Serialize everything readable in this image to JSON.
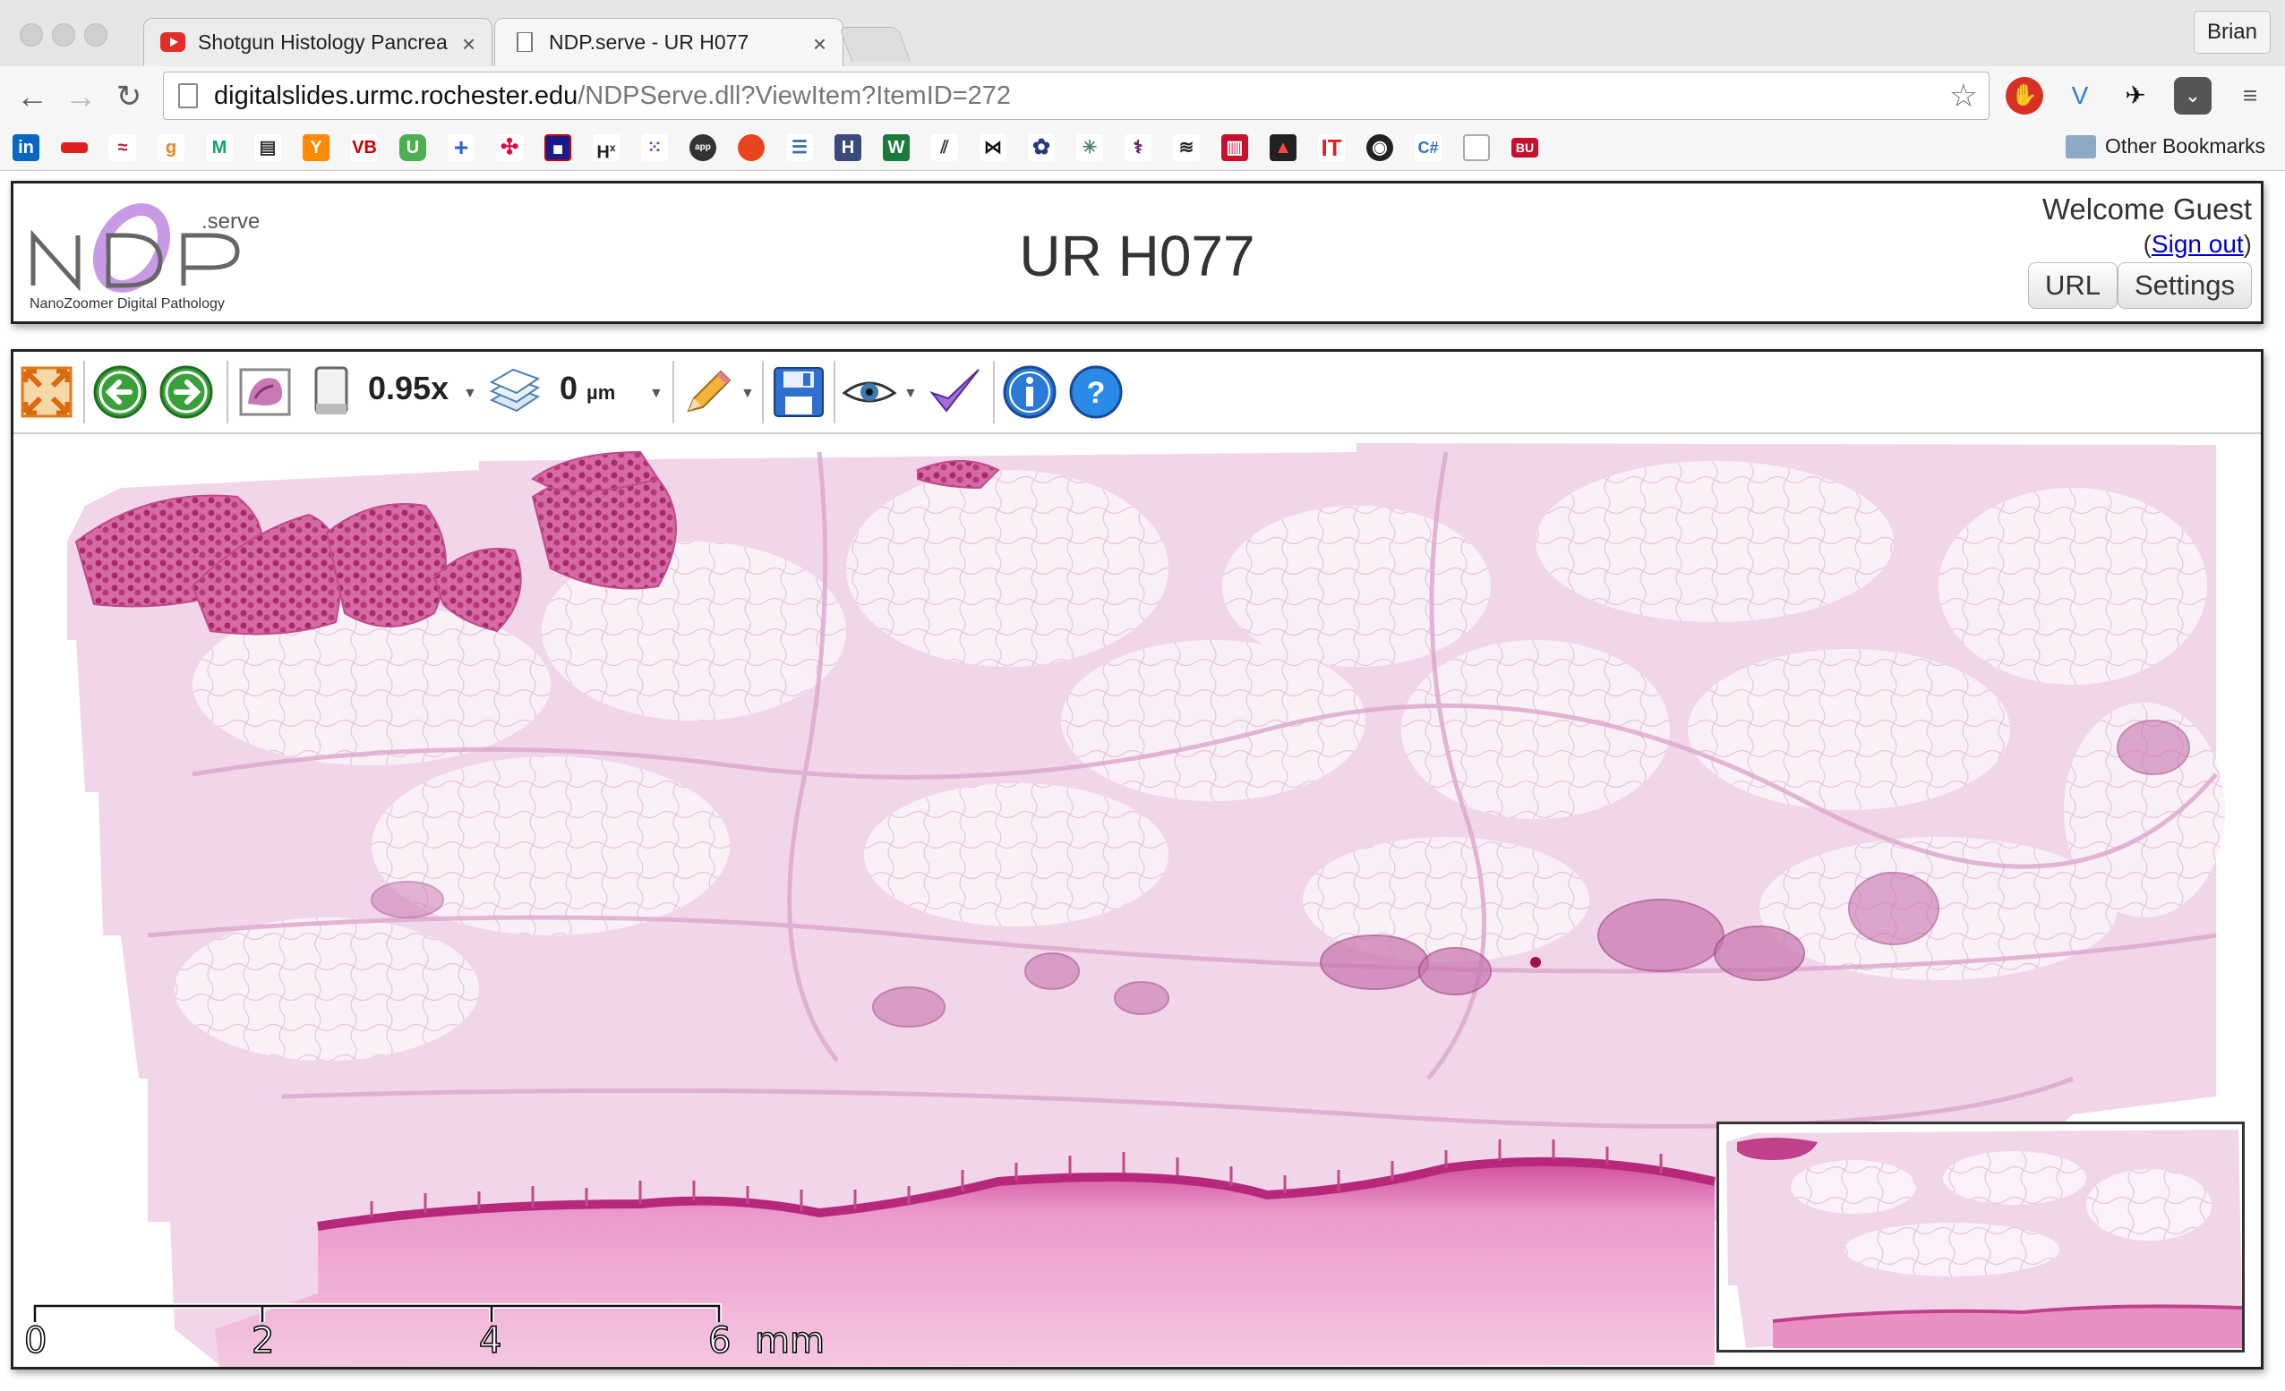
{
  "browser": {
    "tabs": [
      {
        "title": "Shotgun Histology Pancrea",
        "icon": "youtube-icon",
        "active": false
      },
      {
        "title": "NDP.serve - UR H077",
        "icon": "page-icon",
        "active": true
      }
    ],
    "profile_name": "Brian",
    "url_host": "digitalslides.urmc.rochester.edu",
    "url_path": "/NDPServe.dll?ViewItem?ItemID=272",
    "bookmarks_other": "Other Bookmarks",
    "bookmark_icons": [
      "linkedin-icon",
      "bookmark-red-icon",
      "bank-icon",
      "g-icon",
      "m-icon",
      "news-icon",
      "y-icon",
      "vb-icon",
      "u-icon",
      "plus-icon",
      "pinwheel-icon",
      "grid-icon",
      "hx-icon",
      "dots-icon",
      "appress-icon",
      "tomato-icon",
      "database-icon",
      "h-icon",
      "w-icon",
      "stripes-icon",
      "bowtie-icon",
      "flower-icon",
      "network-icon",
      "feather-icon",
      "lines-icon",
      "barchart-icon",
      "dark-icon",
      "it-icon",
      "radio-icon",
      "csharp-icon",
      "doc-icon",
      "bu-icon"
    ]
  },
  "ndp": {
    "logo_serve": ".serve",
    "logo_tagline": "NanoZoomer Digital Pathology",
    "title": "UR H077",
    "welcome": "Welcome Guest",
    "signout_open": "(",
    "signout": "Sign out",
    "signout_close": ")",
    "buttons": {
      "url": "URL",
      "settings": "Settings"
    }
  },
  "viewer": {
    "zoom": "0.95x",
    "depth_value": "0",
    "depth_unit": "µm",
    "scale_labels": [
      "0",
      "2",
      "4",
      "6",
      "mm"
    ]
  },
  "colors": {
    "tissue_pink": "#f1d6ea",
    "muscle_magenta": "#b0306e",
    "epithelium_pink": "#e47cb8"
  }
}
